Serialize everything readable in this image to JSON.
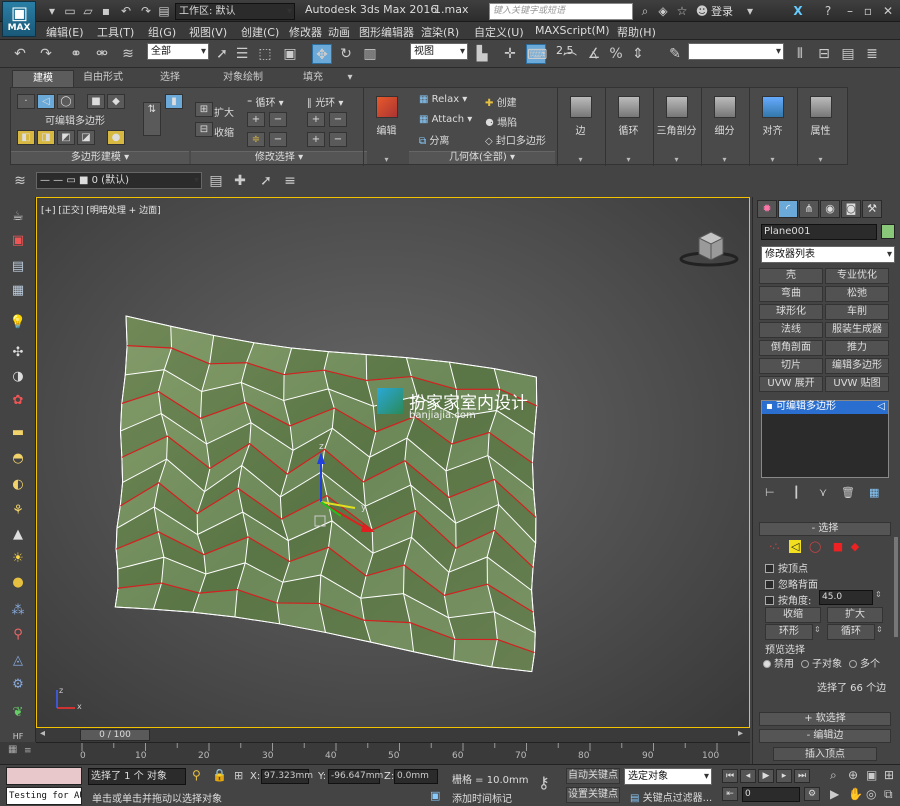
{
  "title_bar": {
    "logo_label": "MAX",
    "workspace_label": "工作区: 默认",
    "app_title": "Autodesk 3ds Max 2016",
    "file_name": "1.max",
    "search_placeholder": "键入关键字或短语",
    "login_label": "登录"
  },
  "menu": [
    "编辑(E)",
    "工具(T)",
    "组(G)",
    "视图(V)",
    "创建(C)",
    "修改器",
    "动画",
    "图形编辑器",
    "渲染(R)",
    "自定义(U)",
    "MAXScript(M)",
    "帮助(H)"
  ],
  "main_toolbar": {
    "selection_filter": "全部",
    "ref_coord": "视图",
    "snap_value": "2.5",
    "named_selection": ""
  },
  "ribbon": {
    "tabs": [
      "建模",
      "自由形式",
      "选择",
      "对象绘制",
      "填充"
    ],
    "active_tab": "建模",
    "poly_label": "可编辑多边形",
    "group_poly_modeling": "多边形建模",
    "grow_label": "扩大",
    "shrink_label": "收缩",
    "loop_label": "循环",
    "ring_label": "光环",
    "group_modify_selection": "修改选择",
    "edit_label": "编辑",
    "relax_label": "Relax",
    "attach_label": "Attach",
    "detach_label": "分离",
    "create_label": "创建",
    "collapse_label": "塌陷",
    "cap_label": "封口多边形",
    "group_geometry": "几何体(全部)",
    "big_buttons": [
      "边",
      "循环",
      "三角剖分",
      "细分",
      "对齐",
      "属性"
    ]
  },
  "layer": {
    "name": "0 (默认)"
  },
  "viewport": {
    "label": "[+] [正交] [明暗处理 + 边面]",
    "watermark_title": "扮家家室内设计",
    "watermark_url": "banjiajia.com",
    "axis_x": "x",
    "axis_y": "y",
    "axis_z": "z"
  },
  "timeline": {
    "frame_label": "0 / 100",
    "ticks": [
      "0",
      "10",
      "20",
      "30",
      "40",
      "50",
      "60",
      "70",
      "80",
      "90",
      "100"
    ]
  },
  "status": {
    "maxscript": "Testing for AU",
    "selected": "选择了 1 个 对象",
    "prompt": "单击或单击并拖动以选择对象",
    "x_label": "X:",
    "x": "97.323mm",
    "y_label": "Y:",
    "y": "-96.647mm",
    "z_label": "Z:",
    "z": "0.0mm",
    "grid": "栅格 = 10.0mm",
    "add_tag": "添加时间标记",
    "auto_key": "自动关键点",
    "set_key": "设置关键点",
    "sel_obj": "选定对象",
    "key_filter": "关键点过滤器...",
    "frame_value": "0"
  },
  "command_panel": {
    "object_name": "Plane001",
    "object_color": "#88c878",
    "modifier_list": "修改器列表",
    "modifiers": [
      "壳",
      "专业优化",
      "弯曲",
      "松弛",
      "球形化",
      "车削",
      "法线",
      "服装生成器",
      "倒角剖面",
      "推力",
      "切片",
      "编辑多边形",
      "UVW 展开",
      "UVW 贴图"
    ],
    "stack_item": "可编辑多边形",
    "selection_title": "选择",
    "by_vertex": "按顶点",
    "ignore_backface": "忽略背面",
    "by_angle": "按角度:",
    "angle_value": "45.0",
    "shrink": "收缩",
    "grow": "扩大",
    "ring": "环形",
    "loop": "循环",
    "preview_title": "预览选择",
    "preview_off": "禁用",
    "preview_sub": "子对象",
    "preview_multi": "多个",
    "sel_count": "选择了 66 个边",
    "soft_sel": "软选择",
    "edit_edges": "编辑边",
    "insert_vertex": "插入顶点"
  },
  "colors": {
    "mesh_fill": "#6f8a55",
    "wire": "#ffffff",
    "selected_edge": "#d42020",
    "viewport_border": "#f2c200",
    "accent": "#2a7fa6"
  }
}
